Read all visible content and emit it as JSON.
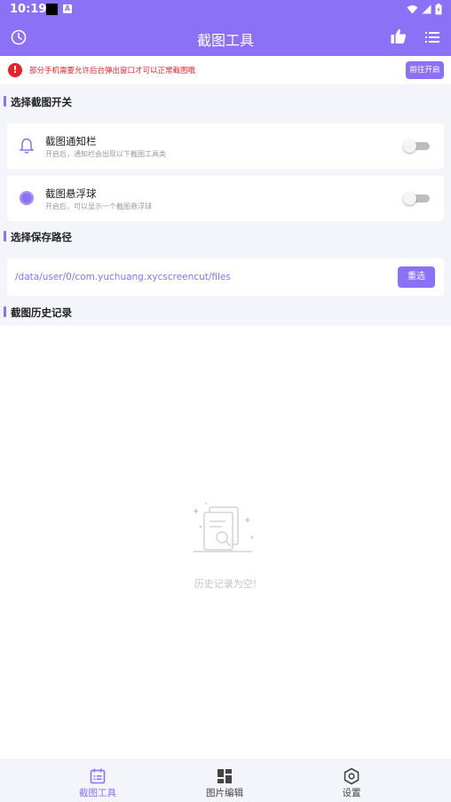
{
  "status_bar": {
    "time": "10:19",
    "a_badge": "A"
  },
  "app_bar": {
    "title": "截图工具"
  },
  "notice": {
    "text": "部分手机需要允许后台弹出窗口才可以正常截图哦",
    "button": "前往开启"
  },
  "section_switch": {
    "title": "选择截图开关"
  },
  "cards": [
    {
      "title": "截图通知栏",
      "desc": "开启后，通知栏会出现以下截图工具类",
      "enabled": false,
      "icon": "bell-icon"
    },
    {
      "title": "截图悬浮球",
      "desc": "开启后，可以显示一个截图悬浮球",
      "enabled": false,
      "icon": "floating-ball-icon"
    }
  ],
  "section_path": {
    "title": "选择保存路径"
  },
  "path": {
    "value": "/data/user/0/com.yuchuang.xycscreencut/files",
    "button": "重选"
  },
  "section_history": {
    "title": "截图历史记录"
  },
  "history": {
    "empty_text": "历史记录为空!"
  },
  "bottom_nav": [
    {
      "label": "截图工具",
      "active": true,
      "icon": "calendar-list-icon"
    },
    {
      "label": "图片编辑",
      "active": false,
      "icon": "grid-icon"
    },
    {
      "label": "设置",
      "active": false,
      "icon": "hexagon-settings-icon"
    }
  ],
  "colors": {
    "accent": "#8a71f6",
    "warning": "#e9222a",
    "background": "#f3f5fa"
  }
}
